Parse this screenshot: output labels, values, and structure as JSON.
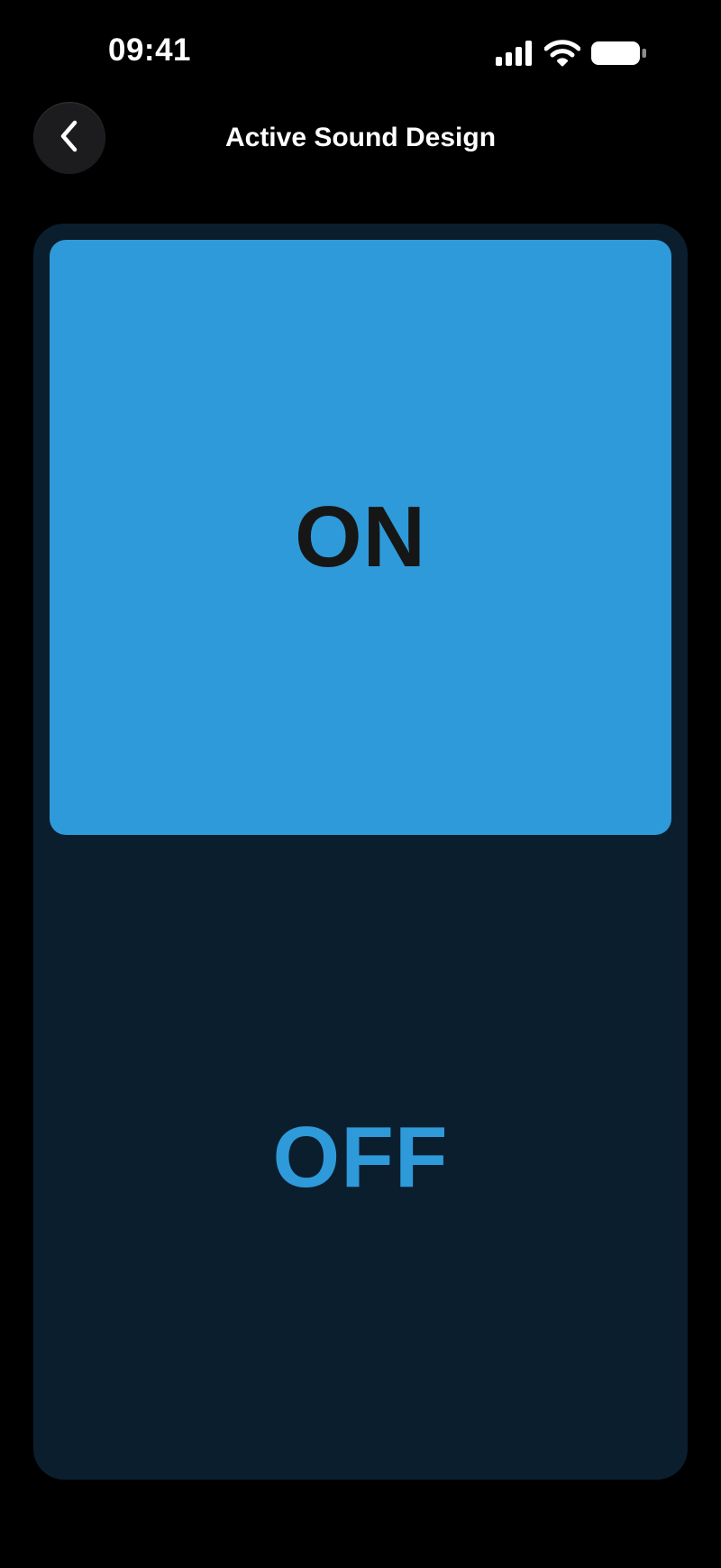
{
  "status_bar": {
    "time": "09:41",
    "icons": [
      "cellular-signal-icon",
      "wifi-icon",
      "battery-icon"
    ]
  },
  "nav": {
    "back_icon": "chevron-left-icon",
    "title": "Active Sound Design"
  },
  "toggle": {
    "selected": "on",
    "options": [
      {
        "id": "on",
        "label": "ON"
      },
      {
        "id": "off",
        "label": "OFF"
      }
    ]
  },
  "colors": {
    "background": "#000000",
    "card_background": "#0b1e2d",
    "accent": "#2e9ad9",
    "selected_text": "#161616",
    "back_button": "#1c1c1e"
  }
}
